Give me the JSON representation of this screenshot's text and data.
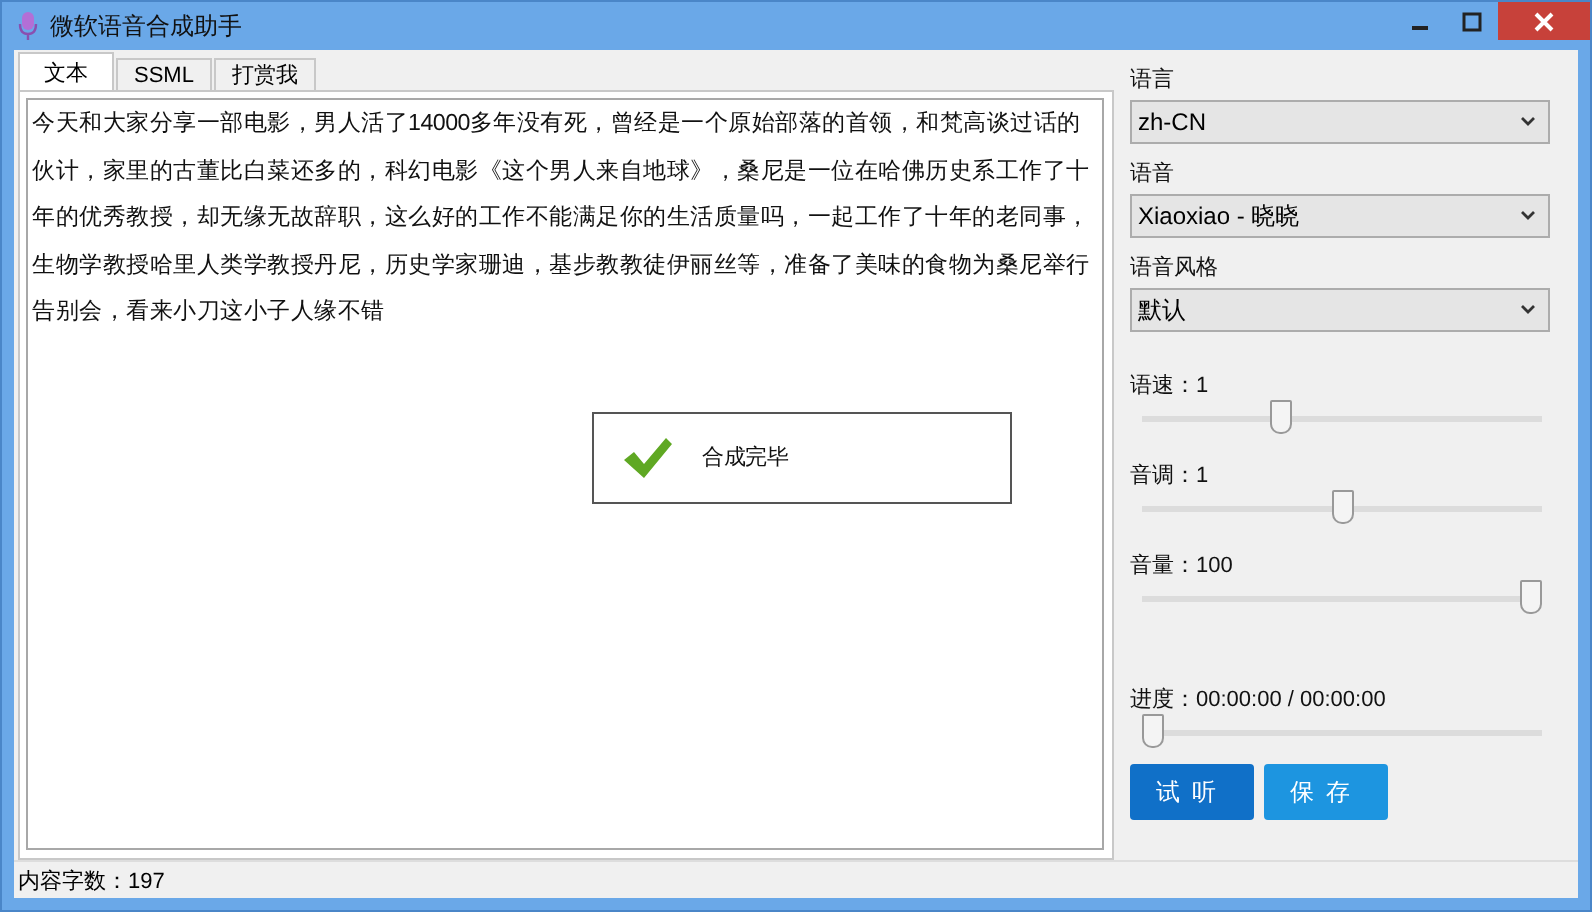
{
  "window": {
    "title": "微软语音合成助手"
  },
  "tabs": [
    {
      "label": "文本",
      "selected": true
    },
    {
      "label": "SSML",
      "selected": false
    },
    {
      "label": "打赏我",
      "selected": false
    }
  ],
  "text_content": "今天和大家分享一部电影，男人活了14000多年没有死，曾经是一个原始部落的首领，和梵高谈过话的伙计，家里的古董比白菜还多的，科幻电影《这个男人来自地球》，桑尼是一位在哈佛历史系工作了十年的优秀教授，却无缘无故辞职，这么好的工作不能满足你的生活质量吗，一起工作了十年的老同事，生物学教授哈里人类学教授丹尼，历史学家珊迪，基步教教徒伊丽丝等，准备了美味的食物为桑尼举行告别会，看来小刀这小子人缘不错",
  "toast": {
    "message": "合成完毕"
  },
  "selects": [
    {
      "label": "语言",
      "value": "zh-CN"
    },
    {
      "label": "语音",
      "value": "Xiaoxiao - 晓晓"
    },
    {
      "label": "语音风格",
      "value": "默认"
    }
  ],
  "sliders": [
    {
      "label": "语速：1",
      "level": 0.34
    },
    {
      "label": "音调：1",
      "level": 0.5
    },
    {
      "label": "音量：100",
      "level": 1
    }
  ],
  "progress": {
    "label": "进度：00:00:00 / 00:00:00",
    "level": 0
  },
  "buttons": [
    "试听",
    "保存"
  ],
  "status_bar": {
    "text": "内容字数：197"
  }
}
